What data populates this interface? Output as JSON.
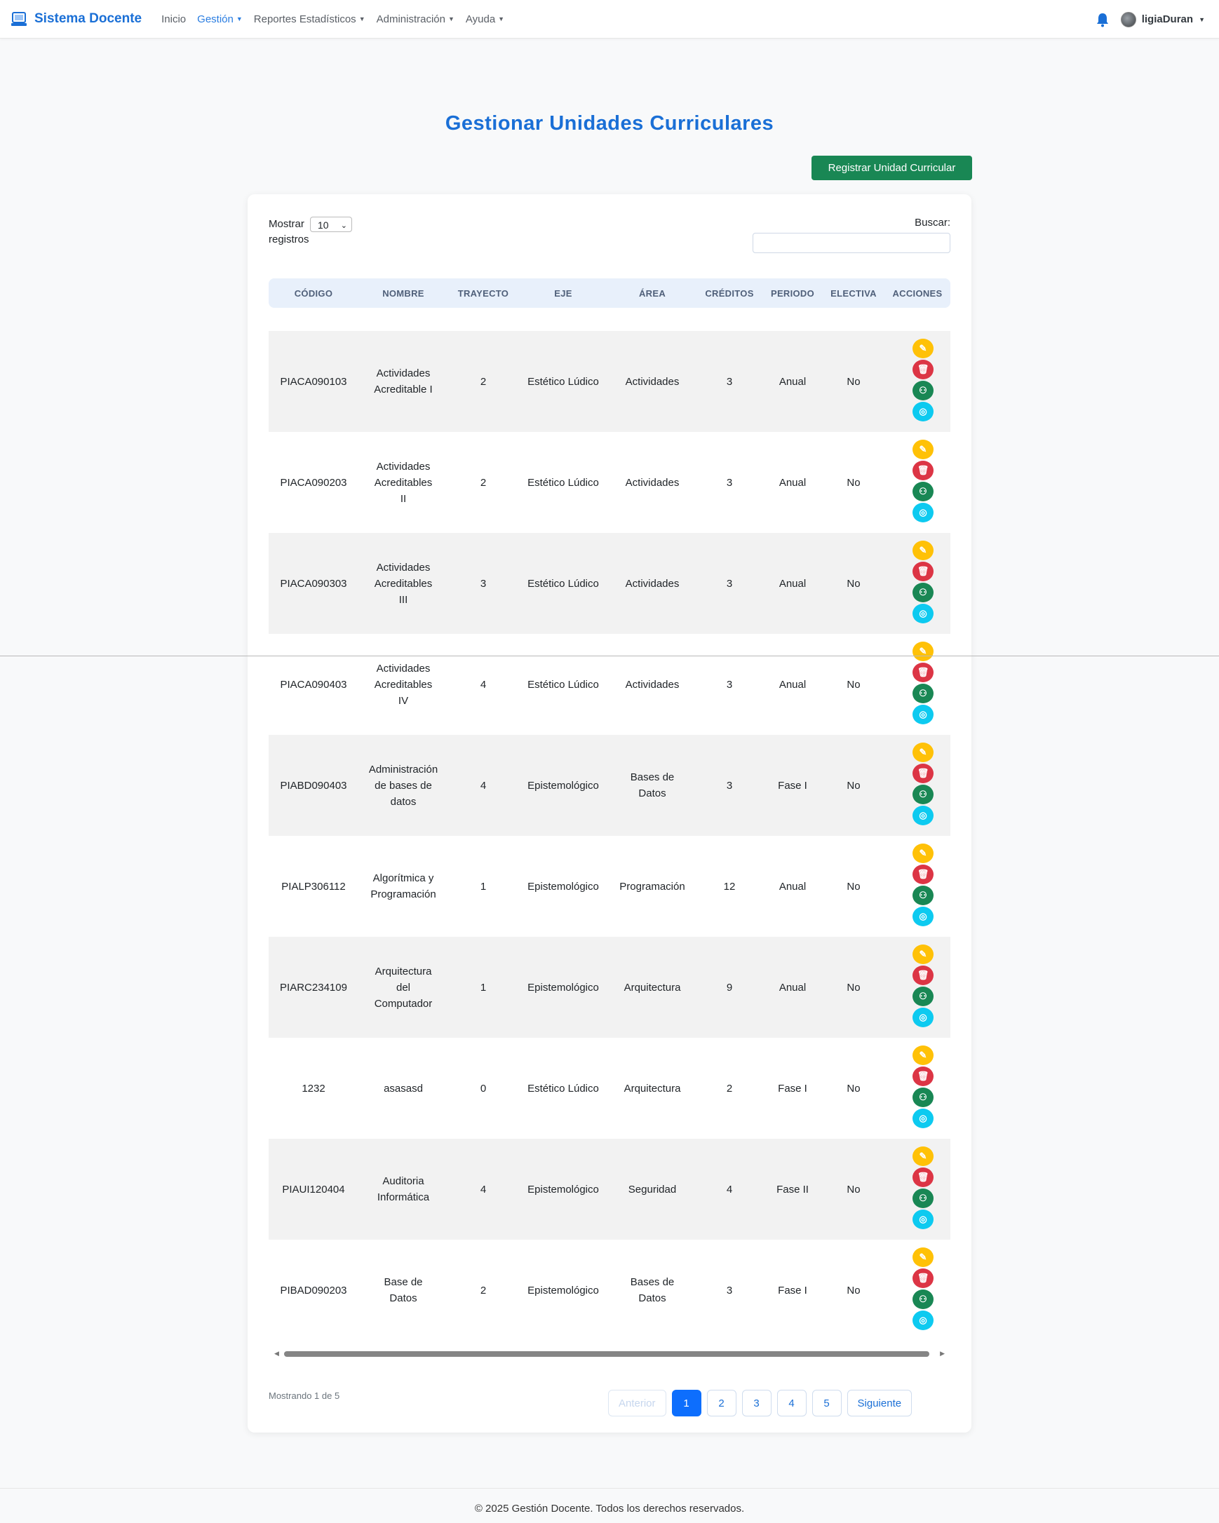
{
  "navbar": {
    "brand": "Sistema Docente",
    "items": [
      {
        "label": "Inicio",
        "dropdown": false,
        "active": false
      },
      {
        "label": "Gestión",
        "dropdown": true,
        "active": true
      },
      {
        "label": "Reportes Estadísticos",
        "dropdown": true,
        "active": false
      },
      {
        "label": "Administración",
        "dropdown": true,
        "active": false
      },
      {
        "label": "Ayuda",
        "dropdown": true,
        "active": false
      }
    ],
    "user": "ligiaDuran"
  },
  "page": {
    "title": "Gestionar Unidades Curriculares",
    "register_button": "Registrar Unidad Curricular"
  },
  "table_controls": {
    "show_label": "Mostrar",
    "show_value": "10",
    "records_label": "registros",
    "search_label": "Buscar:",
    "search_value": ""
  },
  "table": {
    "headers": [
      "CÓDIGO",
      "NOMBRE",
      "TRAYECTO",
      "EJE",
      "ÁREA",
      "CRÉDITOS",
      "PERIODO",
      "ELECTIVA",
      "ACCIONES"
    ],
    "rows": [
      [
        "PIACA090103",
        "Actividades Acreditable I",
        "2",
        "Estético Lúdico",
        "Actividades",
        "3",
        "Anual",
        "No"
      ],
      [
        "PIACA090203",
        "Actividades Acreditables II",
        "2",
        "Estético Lúdico",
        "Actividades",
        "3",
        "Anual",
        "No"
      ],
      [
        "PIACA090303",
        "Actividades Acreditables III",
        "3",
        "Estético Lúdico",
        "Actividades",
        "3",
        "Anual",
        "No"
      ],
      [
        "PIACA090403",
        "Actividades Acreditables IV",
        "4",
        "Estético Lúdico",
        "Actividades",
        "3",
        "Anual",
        "No"
      ],
      [
        "PIABD090403",
        "Administración de bases de datos",
        "4",
        "Epistemológico",
        "Bases de Datos",
        "3",
        "Fase I",
        "No"
      ],
      [
        "PIALP306112",
        "Algorítmica y Programación",
        "1",
        "Epistemológico",
        "Programación",
        "12",
        "Anual",
        "No"
      ],
      [
        "PIARC234109",
        "Arquitectura del Computador",
        "1",
        "Epistemológico",
        "Arquitectura",
        "9",
        "Anual",
        "No"
      ],
      [
        "1232",
        "asasasd",
        "0",
        "Estético Lúdico",
        "Arquitectura",
        "2",
        "Fase I",
        "No"
      ],
      [
        "PIAUI120404",
        "Auditoria Informática",
        "4",
        "Epistemológico",
        "Seguridad",
        "4",
        "Fase II",
        "No"
      ],
      [
        "PIBAD090203",
        "Base de Datos",
        "2",
        "Epistemológico",
        "Bases de Datos",
        "3",
        "Fase I",
        "No"
      ]
    ],
    "action_icons": [
      "edit-icon",
      "trash-icon",
      "assign-teacher-icon",
      "users-icon"
    ]
  },
  "pagination": {
    "info": "Mostrando 1 de 5",
    "previous": "Anterior",
    "pages": [
      "1",
      "2",
      "3",
      "4",
      "5"
    ],
    "current_page": "1",
    "next": "Siguiente"
  },
  "footer": {
    "text": "© 2025 Gestión Docente. Todos los derechos reservados."
  },
  "colors": {
    "brand": "#1a6fd6",
    "success": "#198754",
    "warning": "#ffc107",
    "danger": "#dc3545",
    "info": "#0dcaf0",
    "primary": "#0d6efd"
  }
}
